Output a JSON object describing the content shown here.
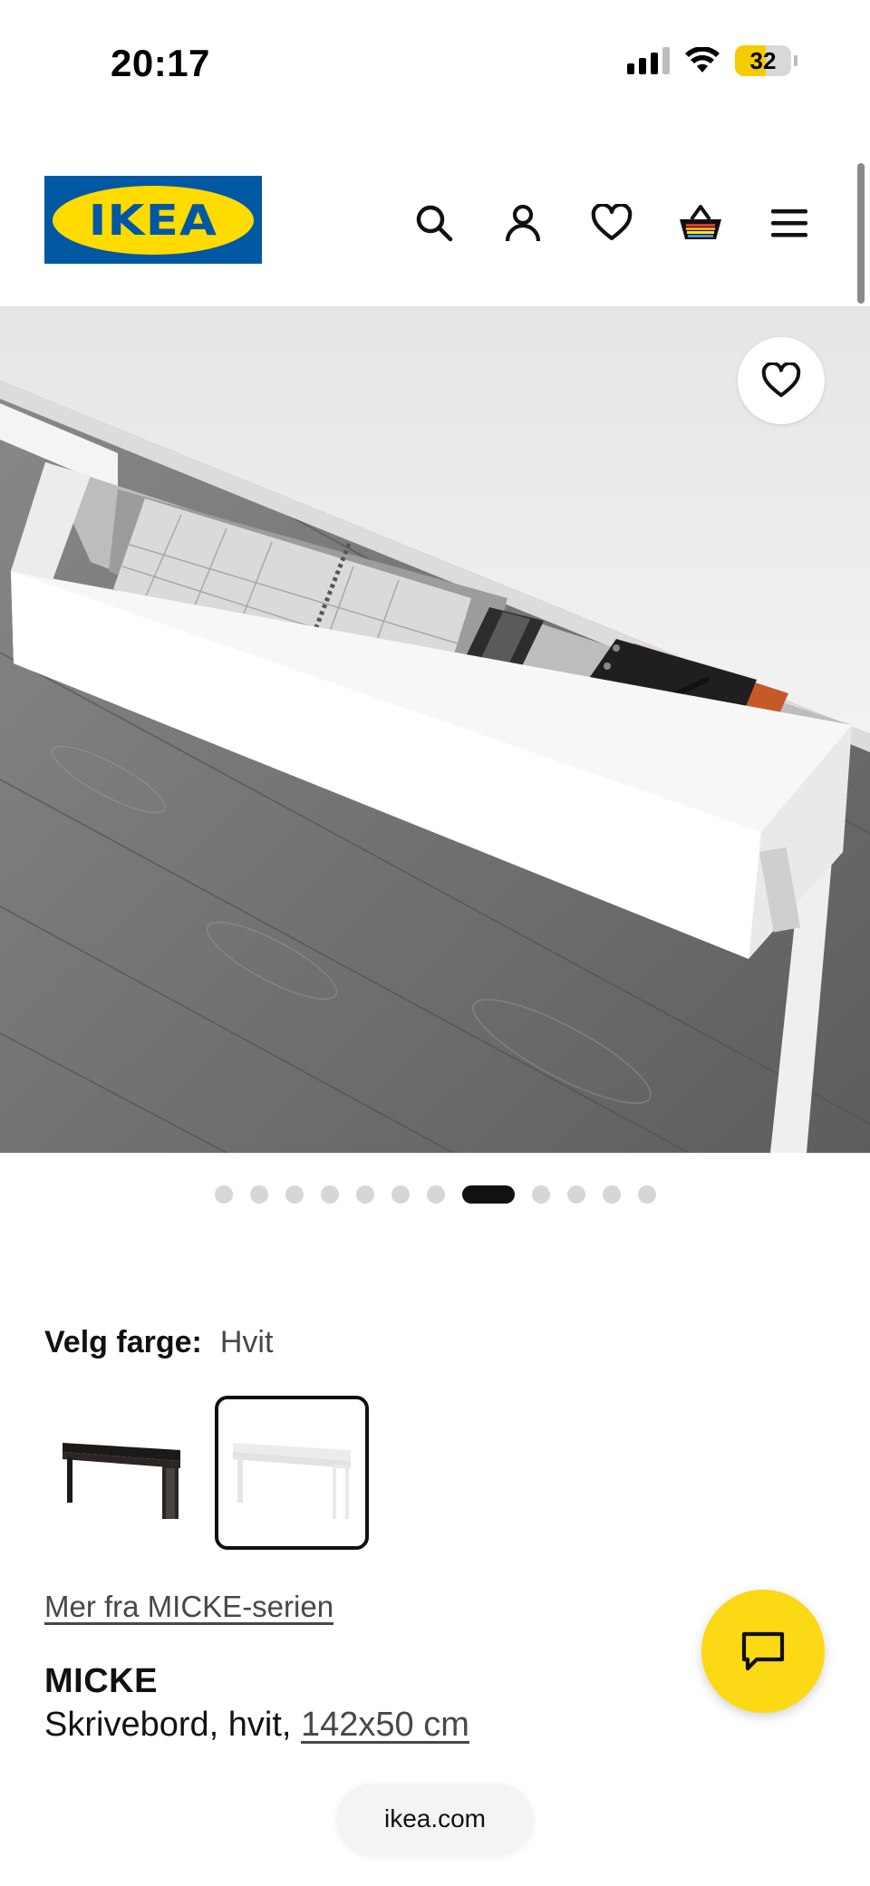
{
  "status_bar": {
    "time": "20:17",
    "battery": "32",
    "battery_level": 0.32,
    "icons": [
      "cellular-signal-icon",
      "wifi-icon",
      "battery-icon"
    ]
  },
  "header": {
    "logo_text": "IKEA",
    "logo_colors": {
      "blue": "#0058a3",
      "yellow": "#ffdb00"
    },
    "nav_icons": [
      "search-icon",
      "account-icon",
      "heart-icon",
      "cart-icon",
      "menu-icon"
    ]
  },
  "gallery": {
    "favorite_icon": "heart-icon",
    "dot_count": 13,
    "active_dot_index": 7
  },
  "color_selector": {
    "label": "Velg farge:",
    "selected_value": "Hvit",
    "options": [
      {
        "color": "#2b2624"
      },
      {
        "color": "#f2f2f2",
        "selected": true
      }
    ]
  },
  "product": {
    "series_link": "Mer fra MICKE-serien",
    "name": "MICKE",
    "description_prefix": "Skrivebord, hvit,",
    "size_link": "142x50 cm"
  },
  "chat": {
    "icon": "chat-bubble-icon",
    "color": "#fbd914"
  },
  "browser": {
    "url": "ikea.com"
  }
}
